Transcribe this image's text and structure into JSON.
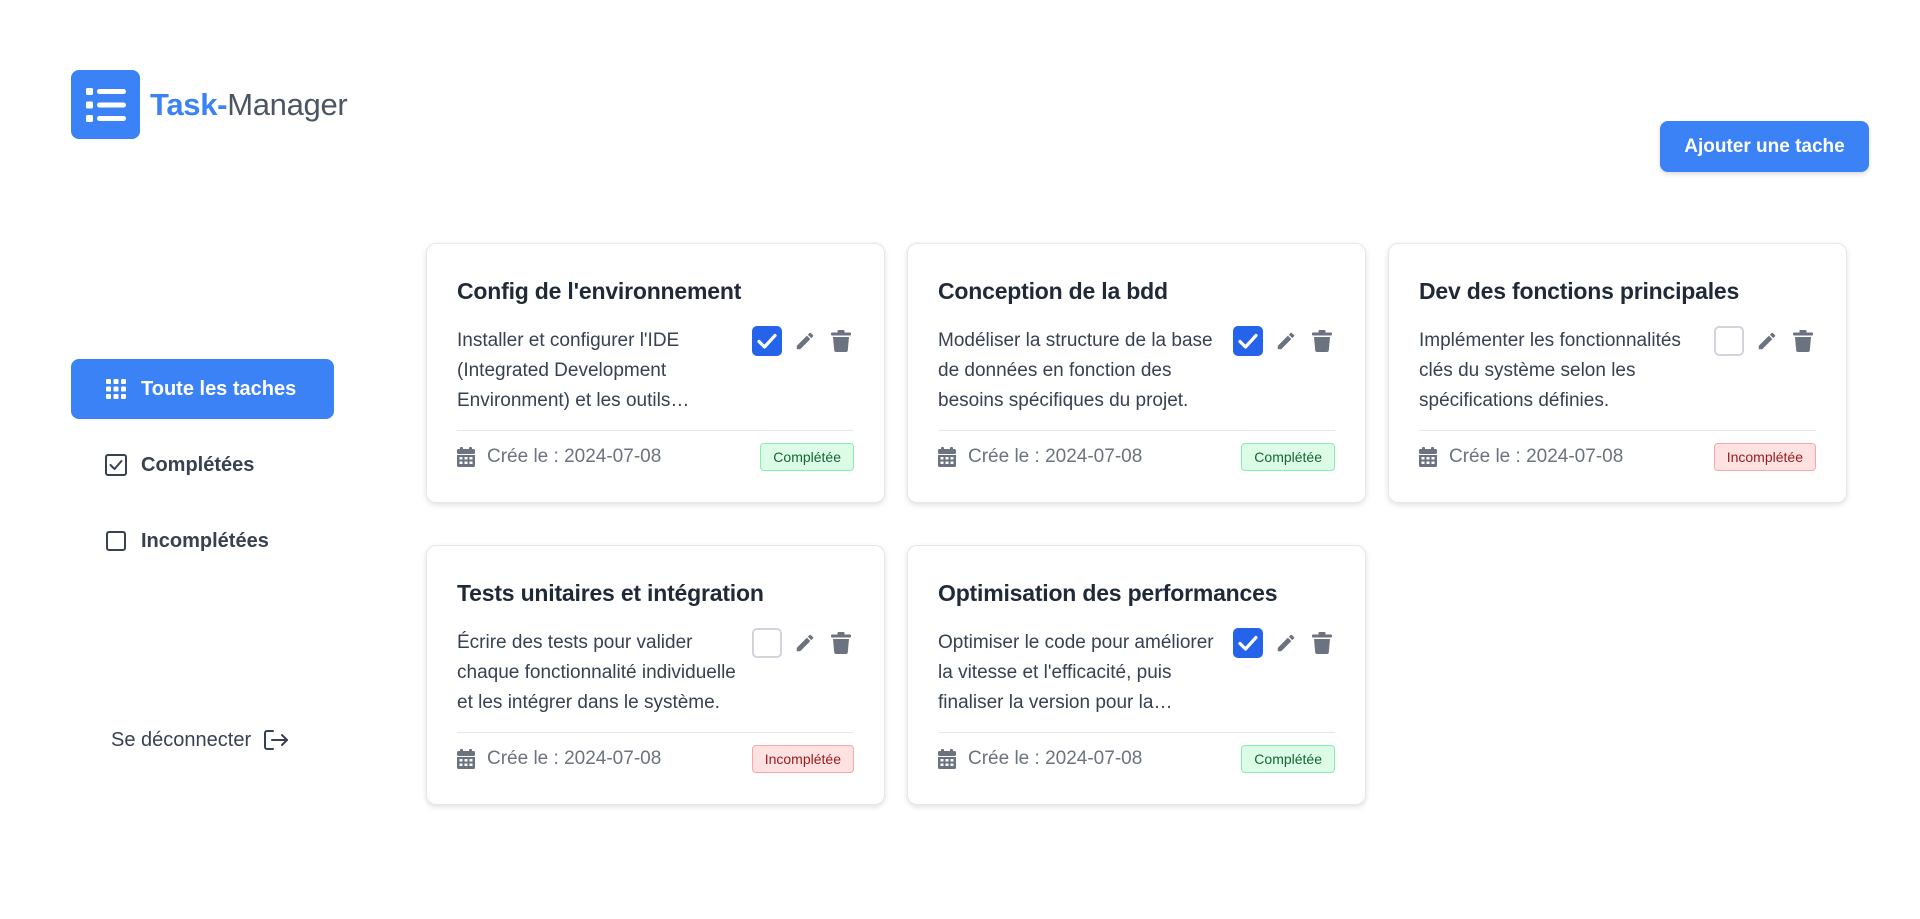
{
  "app": {
    "title_bold": "Task-",
    "title_rest": "Manager",
    "logo_icon": "list-icon"
  },
  "colors": {
    "accent": "#3b82f6",
    "checkbox_on": "#2563eb",
    "done_bg": "#dcfce7",
    "todo_bg": "#fee2e2"
  },
  "header": {
    "add_label": "Ajouter une tache"
  },
  "nav": {
    "all_label": "Toute les taches",
    "done_label": "Complétées",
    "todo_label": "Incomplétées"
  },
  "logout_label": "Se déconnecter",
  "tasks": [
    {
      "title": "Config de l'environnement",
      "desc": "Installer et configurer l'IDE (Integrated Development Environment) et les outils nécessaires.",
      "date": "Crée le : 2024-07-08",
      "done": true,
      "status": "Complétée"
    },
    {
      "title": "Conception de la bdd",
      "desc": "Modéliser la structure de la base de données en fonction des besoins spécifiques du projet.",
      "date": "Crée le : 2024-07-08",
      "done": true,
      "status": "Complétée"
    },
    {
      "title": "Dev des fonctions principales",
      "desc": "Implémenter les fonctionnalités clés du système selon les spécifications définies.",
      "date": "Crée le : 2024-07-08",
      "done": false,
      "status": "Incomplétée"
    },
    {
      "title": "Tests unitaires et intégration",
      "desc": "Écrire des tests pour valider chaque fonctionnalité individuelle et les intégrer dans le système.",
      "date": "Crée le : 2024-07-08",
      "done": false,
      "status": "Incomplétée"
    },
    {
      "title": "Optimisation des performances",
      "desc": "Optimiser le code pour améliorer la vitesse et l'efficacité, puis finaliser la version pour la livraison.",
      "date": "Crée le : 2024-07-08",
      "done": true,
      "status": "Complétée"
    }
  ]
}
